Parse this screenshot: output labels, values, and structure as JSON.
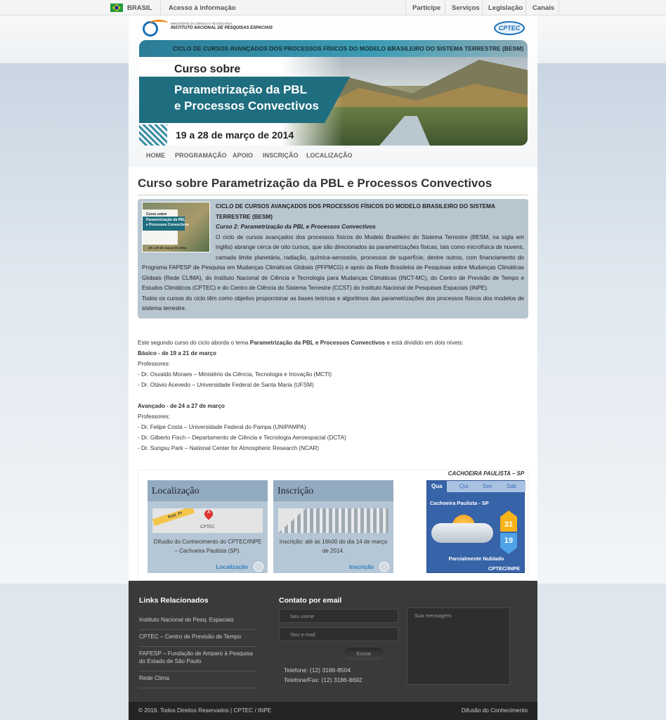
{
  "govbar": {
    "country": "BRASIL",
    "access": "Acesso à informação",
    "nav": [
      "Participe",
      "Serviços",
      "Legislação",
      "Canais"
    ]
  },
  "header": {
    "inpe_subtitle": "MINISTÉRIO DA CIÊNCIA E TECNOLOGIA",
    "inpe_title": "INSTITUTO NACIONAL DE PESQUISAS ESPACIAIS",
    "cptec_logo": "CPTEC",
    "banner": {
      "strip": "CICLO DE CURSOS AVANÇADOS DOS PROCESSOS FÍSICOS DO MODELO BRASILEIRO DO SISTEMA TERRESTRE (BESM)",
      "curso_sobre": "Curso sobre",
      "title_line1": "Parametrização da PBL",
      "title_line2": "e Processos Convectivos",
      "date": "19 a 28 de março de 2014"
    },
    "menu": [
      "HOME",
      "PROGRAMAÇÃO",
      "APOIO",
      "INSCRIÇÃO",
      "LOCALIZAÇÃO"
    ]
  },
  "main": {
    "title": "Curso sobre Parametrização da PBL e Processos Convectivos",
    "thumb": {
      "line1": "Curso sobre",
      "line2": "Parametrização da PBL",
      "line3": "e Processos Convectivos",
      "date": "19 a 28 de março de 2014"
    },
    "box_heading": "CICLO DE CURSOS AVANÇADOS DOS PROCESSOS FÍSICOS DO MODELO BRASILEIRO DO SISTEMA TERRESTRE (BESM)",
    "box_course": "Curso 2: Parametrização da PBL e Processos Convectivos",
    "box_p1": "O ciclo de cursos avançados dos processos físicos do Modelo Brasileiro do Sistema Terrestre (BESM, na sigla em inglês) abrange cerca de oito cursos, que são direcionados às parametrizações físicas, tais como microfísica de nuvens, camada limite planetária, radiação, química-aerossóis, processos de superfície, dentre outros, com financiamento do Programa FAPESP de Pesquisa em Mudanças Climáticas Globais (PFPMCG) e apoio da Rede Brasileira de Pesquisas sobre Mudanças Climáticas Globais (Rede CLIMA), do Instituto Nacional de Ciência e Tecnologia para Mudanças Climáticas (INCT-MC), do Centro de Previsão de Tempo e Estudos Climáticos (CPTEC) e do Centro de Ciência do Sistema Terrestre (CCST) do Instituto Nacional de Pesquisas Espaciais (INPE).",
    "box_p2": "Todos os cursos do ciclo têm como objetivo proporcionar as bases teóricas e algoritmos das parametrizações dos processos físicos dos modelos de sistema terrestre.",
    "intro_pre": "Este segundo curso do ciclo aborda o tema ",
    "intro_bold": "Parametrização da PBL e Processos Convectivos",
    "intro_post": " e está dividido em dois níveis:",
    "basic_heading": "Básico - de 19 a 21 de março",
    "basic_prof_label": "Professores:",
    "basic_profs": [
      "- Dr. Osvaldo Moraes – Ministério da Ciência, Tecnologia e Inovação (MCTI)",
      "- Dr. Otávio Acevedo – Universidade Federal de Santa Maria (UFSM)"
    ],
    "adv_heading": "Avançado - de 24 a 27 de março",
    "adv_prof_label": "Professores:",
    "adv_profs": [
      "- Dr. Felipe Costa – Universidade Federal do Pampa (UNIPAMPA)",
      "- Dr.  Gilberto Fisch – Departamento de Ciência e Tecnologia Aeroespacial (DCTA)",
      "- Dr. Sungsu Park – National Center for Atmospheric Research (NCAR)"
    ]
  },
  "cards": {
    "location": {
      "title": "Localização",
      "map_road": "Rod. Pr",
      "map_pin": "A",
      "map_label": "CPTEC",
      "text": "Difusão do Conhecimento do CPTEC/INPE – Cachoeira Paulista (SP).",
      "link": "Localização"
    },
    "registration": {
      "title": "Inscrição",
      "text": "Inscrição: até às 16h00 do dia 14 de março de 2014.",
      "link": "Inscrição"
    },
    "arrow": "›"
  },
  "weather": {
    "title": "CACHOEIRA PAULISTA – SP",
    "days": [
      "Qua",
      "Qui",
      "Sex",
      "Sab"
    ],
    "city": "Cachoeira Paulista - SP",
    "max": "31",
    "min": "19",
    "condition": "Parcialmente Nublado",
    "brand": "CPTEC/INPE"
  },
  "footer": {
    "links_title": "Links Relacionados",
    "links": [
      "Instituto Nacional de Pesq. Espaciais",
      "CPTEC – Centro de Previsão de Tempo",
      "FAPESP – Fundação de Amparo à Pesquisa do Estado de São Paulo",
      "Rede Clima"
    ],
    "contact_title": "Contato por email",
    "name_placeholder": "Seu nome",
    "email_placeholder": "Seu e-mail",
    "message_placeholder": "Sua mensagem",
    "send": "Enviar",
    "phone": "Telefone: (12) 3186-8504",
    "fax": "Telefone/Fax: (12) 3186-8692",
    "copyright": "© 2016. Todos Direitos Reservados | CPTEC / INPE",
    "right": "Difusão do Conhecimento"
  }
}
